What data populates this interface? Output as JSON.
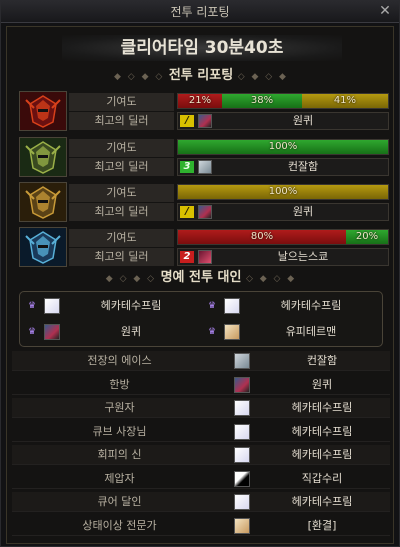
{
  "window": {
    "title": "전투 리포팅",
    "close": "✕"
  },
  "clear_time": "클리어타임  30분40초",
  "report_section": {
    "title": "전투 리포팅",
    "dots_left": "◆ ◇ ◆ ◇",
    "dots_right": "◇ ◆ ◇ ◆"
  },
  "labels": {
    "contribution": "기여도",
    "top_dealer": "최고의 딜러"
  },
  "players": [
    {
      "portrait_icon": "red-armor-portrait",
      "bars": [
        {
          "value": 21,
          "label": "21%",
          "color": "red"
        },
        {
          "value": 38,
          "label": "38%",
          "color": "green"
        },
        {
          "value": 41,
          "label": "41%",
          "color": "gold"
        }
      ],
      "dealer": {
        "badge": "/",
        "badge_color": "yellow",
        "avatar": "dark",
        "name": "원퀴"
      }
    },
    {
      "portrait_icon": "green-armor-portrait",
      "bars": [
        {
          "value": 100,
          "label": "100%",
          "color": "green"
        }
      ],
      "dealer": {
        "badge": "3",
        "badge_color": "green",
        "avatar": "gray",
        "name": "컨잘함"
      }
    },
    {
      "portrait_icon": "gold-armor-portrait",
      "bars": [
        {
          "value": 100,
          "label": "100%",
          "color": "gold"
        }
      ],
      "dealer": {
        "badge": "/",
        "badge_color": "yellow",
        "avatar": "dark",
        "name": "원퀴"
      }
    },
    {
      "portrait_icon": "blue-armor-portrait",
      "bars": [
        {
          "value": 80,
          "label": "80%",
          "color": "red"
        },
        {
          "value": 20,
          "label": "20%",
          "color": "green"
        }
      ],
      "dealer": {
        "badge": "2",
        "badge_color": "red",
        "avatar": "pink",
        "name": "날으는스쿄"
      }
    }
  ],
  "honor_section": {
    "title": "명예 전투 대인",
    "dots_left": "◆ ◇ ◆ ◇",
    "dots_right": "◇ ◆ ◇ ◆"
  },
  "honor": [
    {
      "avatar": "white",
      "name": "헤카테수프림"
    },
    {
      "avatar": "white",
      "name": "헤카테수프림"
    },
    {
      "avatar": "dark",
      "name": "원퀴"
    },
    {
      "avatar": "blond",
      "name": "유피테르맨"
    }
  ],
  "awards": [
    {
      "title": "전장의 에이스",
      "avatar": "gray",
      "name": "컨잘함"
    },
    {
      "title": "한방",
      "avatar": "dark",
      "name": "원퀴"
    },
    {
      "title": "구원자",
      "avatar": "white",
      "name": "헤카테수프림"
    },
    {
      "title": "큐브 사장님",
      "avatar": "white",
      "name": "헤카테수프림"
    },
    {
      "title": "회피의 신",
      "avatar": "white",
      "name": "헤카테수프림"
    },
    {
      "title": "제압자",
      "avatar": "black",
      "name": "직갑수리"
    },
    {
      "title": "큐어 달인",
      "avatar": "white",
      "name": "헤카테수프림"
    },
    {
      "title": "상태이상 전문가",
      "avatar": "blond",
      "name": "[환결]"
    }
  ]
}
